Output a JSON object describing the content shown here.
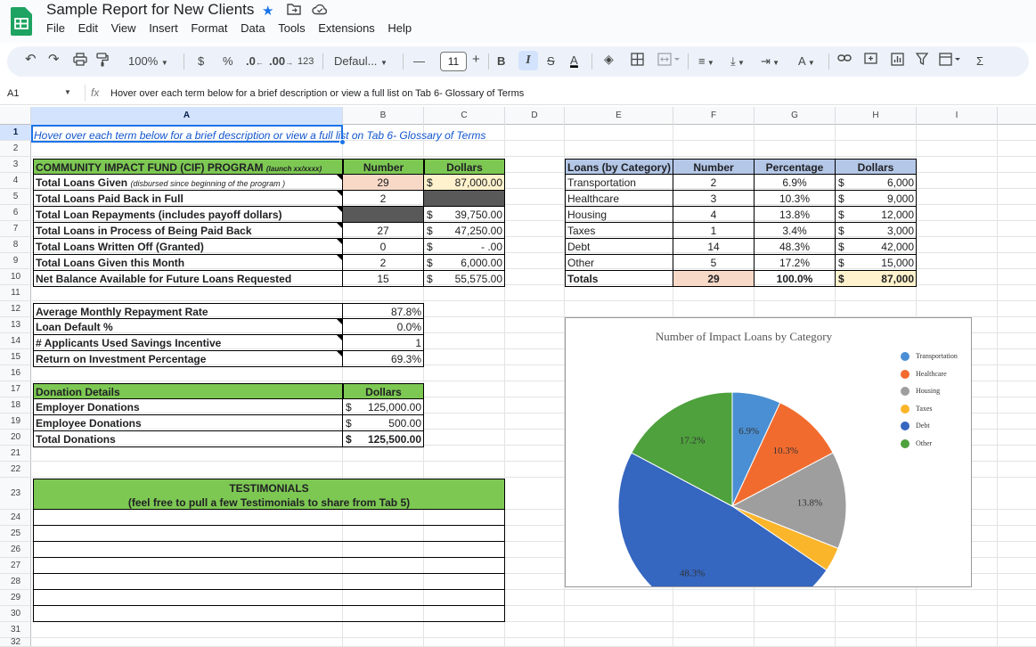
{
  "app": {
    "title": "Sample Report for New Clients",
    "menu": [
      "File",
      "Edit",
      "View",
      "Insert",
      "Format",
      "Data",
      "Tools",
      "Extensions",
      "Help"
    ],
    "title_icons": [
      "star-icon",
      "move-to-folder-icon",
      "cloud-saved-icon"
    ]
  },
  "toolbar": {
    "zoom": "100%",
    "currency": "$",
    "percent": "%",
    "dec_less": ".0",
    "dec_more": ".00",
    "format_123": "123",
    "font": "Defaul...",
    "font_size": "11",
    "minus": "—",
    "plus": "+",
    "bold": "B",
    "italic": "I",
    "sigma": "Σ"
  },
  "formula": {
    "cell": "A1",
    "fx": "fx",
    "text": "Hover over each term below for a brief description or view a full list on Tab 6- Glossary of Terms"
  },
  "columns": [
    "A",
    "B",
    "C",
    "D",
    "E",
    "F",
    "G",
    "H",
    "I"
  ],
  "rows": [
    "1",
    "2",
    "3",
    "4",
    "5",
    "6",
    "7",
    "8",
    "9",
    "10",
    "11",
    "12",
    "13",
    "14",
    "15",
    "16",
    "17",
    "18",
    "19",
    "20",
    "21",
    "22",
    "23",
    "24",
    "25",
    "26",
    "27",
    "28",
    "29",
    "30",
    "31",
    "32"
  ],
  "sheet": {
    "a1": "Hover over each term below for a brief description or view a full list on Tab 6- Glossary of Terms",
    "program": {
      "title": "COMMUNITY IMPACT FUND (CIF) PROGRAM",
      "title_note": "(launch xx/xxxx)",
      "col_number": "Number",
      "col_dollars": "Dollars",
      "rows": [
        {
          "label": "Total Loans Given",
          "note": "(disbursed since beginning of the program )",
          "number": "29",
          "cur": "$",
          "dollars": "87,000.00"
        },
        {
          "label": "Total Loans Paid Back in Full",
          "number": "2",
          "cur": "",
          "dollars": ""
        },
        {
          "label": "Total Loan Repayments (includes payoff dollars)",
          "number": "",
          "cur": "$",
          "dollars": "39,750.00"
        },
        {
          "label": "Total Loans in Process of Being Paid Back",
          "number": "27",
          "cur": "$",
          "dollars": "47,250.00"
        },
        {
          "label": "Total Loans Written Off (Granted)",
          "number": "0",
          "cur": "$",
          "dollars": "-   .00"
        },
        {
          "label": "Total Loans Given this Month",
          "number": "2",
          "cur": "$",
          "dollars": "6,000.00"
        },
        {
          "label": "Net Balance Available for Future Loans Requested",
          "number": "15",
          "cur": "$",
          "dollars": "55,575.00"
        }
      ]
    },
    "metrics": [
      {
        "label": "Average Monthly Repayment Rate",
        "value": "87.8%"
      },
      {
        "label": "Loan Default %",
        "value": "0.0%"
      },
      {
        "label": "# Applicants Used Savings Incentive",
        "value": "1"
      },
      {
        "label": "Return on Investment Percentage",
        "value": "69.3%"
      }
    ],
    "donations": {
      "title": "Donation Details",
      "col": "Dollars",
      "rows": [
        {
          "label": "Employer Donations",
          "cur": "$",
          "value": "125,000.00"
        },
        {
          "label": "Employee Donations",
          "cur": "$",
          "value": "500.00"
        },
        {
          "label": "Total Donations",
          "cur": "$",
          "value": "125,500.00"
        }
      ]
    },
    "testimonials": {
      "title": "TESTIMONIALS",
      "subtitle": "(feel free to pull a few Testimonials to share from Tab 5)"
    },
    "category_table": {
      "headers": [
        "Loans (by Category)",
        "Number",
        "Percentage",
        "Dollars"
      ],
      "rows": [
        {
          "cat": "Transportation",
          "num": "2",
          "pct": "6.9%",
          "cur": "$",
          "dol": "6,000"
        },
        {
          "cat": "Healthcare",
          "num": "3",
          "pct": "10.3%",
          "cur": "$",
          "dol": "9,000"
        },
        {
          "cat": "Housing",
          "num": "4",
          "pct": "13.8%",
          "cur": "$",
          "dol": "12,000"
        },
        {
          "cat": "Taxes",
          "num": "1",
          "pct": "3.4%",
          "cur": "$",
          "dol": "3,000"
        },
        {
          "cat": "Debt",
          "num": "14",
          "pct": "48.3%",
          "cur": "$",
          "dol": "42,000"
        },
        {
          "cat": "Other",
          "num": "5",
          "pct": "17.2%",
          "cur": "$",
          "dol": "15,000"
        }
      ],
      "totals": {
        "cat": "Totals",
        "num": "29",
        "pct": "100.0%",
        "cur": "$",
        "dol": "87,000"
      }
    }
  },
  "chart_data": {
    "type": "pie",
    "title": "Number of Impact Loans by Category",
    "categories": [
      "Transportation",
      "Healthcare",
      "Housing",
      "Taxes",
      "Debt",
      "Other"
    ],
    "values": [
      2,
      3,
      4,
      1,
      14,
      5
    ],
    "slice_labels": [
      "6.9%",
      "10.3%",
      "13.8%",
      "",
      "48.3%",
      "17.2%"
    ],
    "colors": [
      "#4a8fd3",
      "#f26b2e",
      "#9e9e9e",
      "#fbb52b",
      "#3566c0",
      "#4ea13d"
    ],
    "legend": "right"
  }
}
